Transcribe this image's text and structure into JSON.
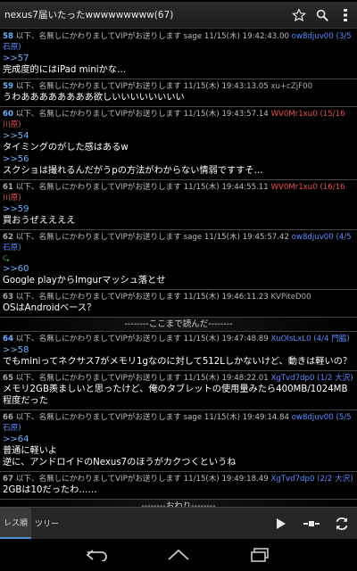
{
  "app": {
    "title": "nexus7届いたったwwwwwwwww(67)"
  },
  "posts": [
    {
      "num": "58",
      "num_color": "blue",
      "header": "以下、名無しにかわりましてVIPがお送りします sage 11/15(木) 19:42:43.00",
      "id": "ow8djuv00 (3/5 石原)",
      "id_color": "blue",
      "lines": [
        {
          "type": "anchor",
          "text": ">>57"
        },
        {
          "type": "text",
          "text": "完成度的にはiPad miniかな…"
        }
      ]
    },
    {
      "num": "59",
      "num_color": "blue",
      "header": "以下、名無しにかわりましてVIPがお送りします 11/15(木) 19:43:13.05",
      "id": "xu+cZjF00",
      "id_color": "gray",
      "lines": [
        {
          "type": "text",
          "text": "うわああああああああ欲しいいいいいいいい"
        }
      ]
    },
    {
      "num": "60",
      "num_color": "blue",
      "header": "以下、名無しにかわりましてVIPがお送りします 11/15(木) 19:43:57.14",
      "id": "WV0Mr1xu0 (15/16 川原)",
      "id_color": "red",
      "lines": [
        {
          "type": "anchor",
          "text": ">>54"
        },
        {
          "type": "text",
          "text": "タイミングのがした感はあるw"
        },
        {
          "type": "anchor",
          "text": ">>56"
        },
        {
          "type": "text",
          "text": "スクショは撮れるんだがうpの方法がわからない情弱ですすそ…"
        }
      ]
    },
    {
      "num": "61",
      "num_color": "gray",
      "header": "以下、名無しにかわりましてVIPがお送りします 11/15(木) 19:44:55.11",
      "id": "WV0Mr1xu0 (16/16 川原)",
      "id_color": "red",
      "lines": [
        {
          "type": "anchor",
          "text": ">>59"
        },
        {
          "type": "text",
          "text": "買おうぜええええ"
        }
      ]
    },
    {
      "num": "62",
      "num_color": "gray",
      "header": "以下、名無しにかわりましてVIPがお送りします sage 11/15(木) 19:45:57.42",
      "id": "ow8djuv00 (4/5 石原)",
      "id_color": "blue",
      "reply_mark": "⮎",
      "lines": [
        {
          "type": "anchor",
          "text": ">>60"
        },
        {
          "type": "text",
          "text": "Google playからImgurマッシュ落とせ"
        }
      ]
    },
    {
      "num": "63",
      "num_color": "gray",
      "header": "以下、名無しにかわりましてVIPがお送りします 11/15(木) 19:46:11.23",
      "id": "KVPiteD00",
      "id_color": "gray",
      "lines": [
        {
          "type": "text",
          "text": "OSはAndroidベース？"
        }
      ]
    }
  ],
  "read_divider": "--------ここまで読んだ--------",
  "posts2": [
    {
      "num": "64",
      "num_color": "blue",
      "header": "以下、名無しにかわりましてVIPがお送りします 11/15(木) 19:47:48.89",
      "id": "XuOlsLxL0 (4/4 門脇)",
      "id_color": "blue",
      "lines": [
        {
          "type": "anchor",
          "text": ">>58"
        },
        {
          "type": "text",
          "text": "でもminiってネクサス7がメモリ1gなのに対して512Lしかないけど、動きは軽いの？"
        }
      ]
    },
    {
      "num": "65",
      "num_color": "gray",
      "header": "以下、名無しにかわりましてVIPがお送りします 11/15(木) 19:48:22.01",
      "id": "XgTvd7dp0 (1/2 大沢)",
      "id_color": "blue",
      "lines": [
        {
          "type": "text",
          "text": "メモリ2GB羨ましいと思ったけど、俺のタブレットの使用量みたら400MB/1024MB程度だった"
        }
      ]
    },
    {
      "num": "66",
      "num_color": "gray",
      "header": "以下、名無しにかわりましてVIPがお送りします sage 11/15(木) 19:49:14.84",
      "id": "ow8djuv00 (5/5 石原)",
      "id_color": "blue",
      "lines": [
        {
          "type": "anchor",
          "text": ">>64"
        },
        {
          "type": "text",
          "text": "普通に軽いよ"
        },
        {
          "type": "text",
          "text": "逆に、アンドロイドのNexus7のほうがカクつくというね"
        }
      ]
    },
    {
      "num": "67",
      "num_color": "gray",
      "header": "以下、名無しにかわりましてVIPがお送りします 11/15(木) 19:49:18.49",
      "id": "XgTvd7dp0 (2/2 大沢)",
      "id_color": "blue",
      "lines": [
        {
          "type": "text",
          "text": "2GBは10だったわ……"
        }
      ]
    }
  ],
  "end_divider": "--------おわり--------",
  "tabs": [
    {
      "label": "レス順",
      "active": true
    },
    {
      "label": "ツリー",
      "active": false
    }
  ],
  "icons": {
    "star": "star-icon",
    "search": "search-icon",
    "menu": "overflow-menu-icon",
    "play": "play-icon",
    "jump": "jump-icon",
    "refresh": "refresh-icon",
    "back": "back-icon",
    "home": "home-icon",
    "recent": "recent-apps-icon"
  },
  "colors": {
    "anchor": "#6fb1ff",
    "id_red": "#e65050",
    "id_blue": "#5b8cff",
    "tab_accent": "#4a8fd0"
  }
}
